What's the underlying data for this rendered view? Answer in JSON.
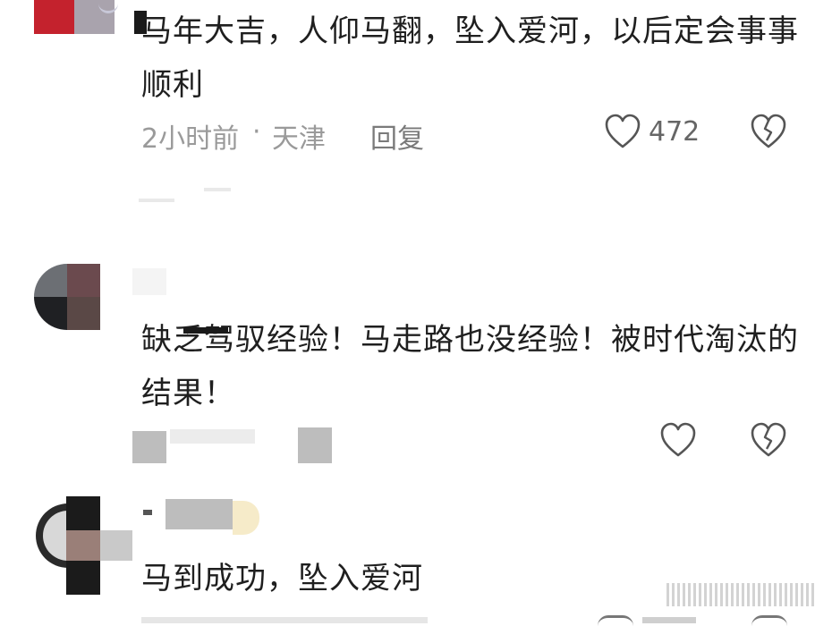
{
  "comments": [
    {
      "text": "马年大吉，人仰马翻，坠入爱河，以后定会事事顺利",
      "time": "2小时前",
      "location": "天津",
      "reply": "回复",
      "likes": "472"
    },
    {
      "text": "缺乏驾驭经验！马走路也没经验！被时代淘汰的结果！",
      "time": "",
      "location": "",
      "reply": "",
      "likes": ""
    },
    {
      "text": "马到成功，坠入爱河",
      "time": "",
      "location": "",
      "reply": "",
      "likes": ""
    }
  ],
  "separator": "·",
  "icons": {
    "like": "heart-outline-icon",
    "dislike": "broken-heart-icon"
  }
}
